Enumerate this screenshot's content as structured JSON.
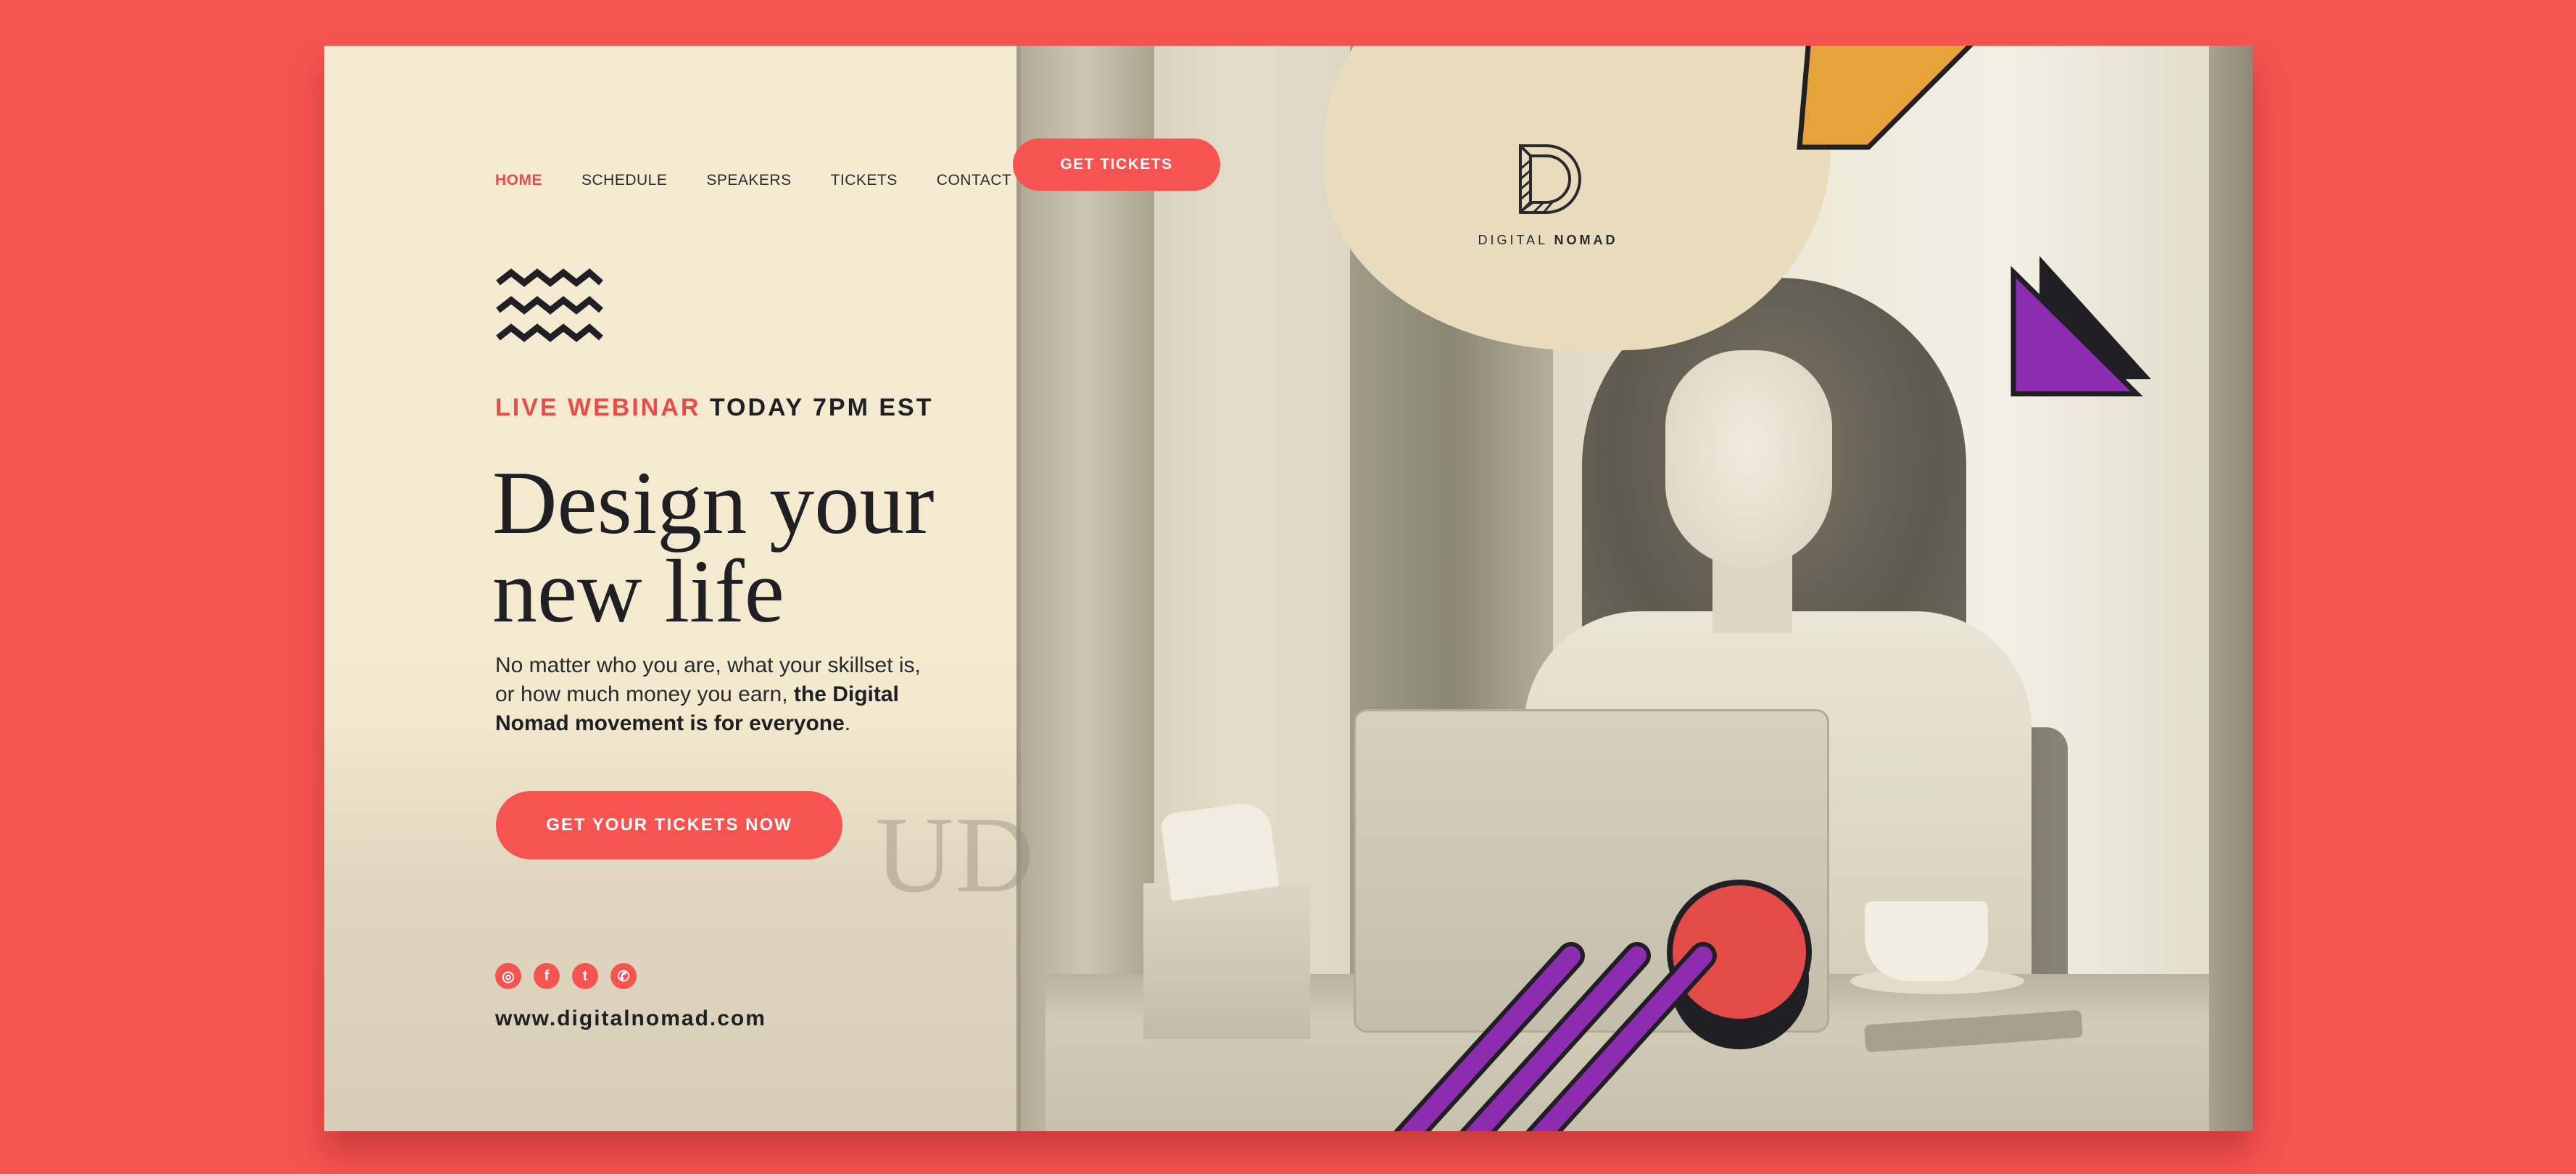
{
  "nav": {
    "items": [
      {
        "label": "HOME",
        "active": true
      },
      {
        "label": "SCHEDULE",
        "active": false
      },
      {
        "label": "SPEAKERS",
        "active": false
      },
      {
        "label": "TICKETS",
        "active": false
      },
      {
        "label": "CONTACT",
        "active": false
      }
    ],
    "cta_label": "GET TICKETS"
  },
  "logo": {
    "name_light": "DIGITAL",
    "name_bold": "NOMAD",
    "icon": "letter-d-icon"
  },
  "hero": {
    "eyebrow_accent": "LIVE WEBINAR",
    "eyebrow_rest": "TODAY 7PM EST",
    "headline_line1": "Design your",
    "headline_line2": "new life",
    "body_plain": "No matter who you are, what your skillset is, or how much money you earn,",
    "body_bold": "the Digital Nomad movement is for everyone",
    "body_end": ".",
    "cta_label": "GET YOUR TICKETS NOW"
  },
  "footer": {
    "socials": [
      {
        "icon": "instagram-icon",
        "glyph": "◎"
      },
      {
        "icon": "facebook-icon",
        "glyph": "f"
      },
      {
        "icon": "twitter-icon",
        "glyph": "t"
      },
      {
        "icon": "whatsapp-icon",
        "glyph": "✆"
      }
    ],
    "url": "www.digitalnomad.com"
  },
  "colors": {
    "accent": "#f75351",
    "background": "#f75351",
    "cream": "#f3ead3",
    "purple": "#8e2cb1",
    "orange": "#e8a23a",
    "dark": "#1f1f24"
  }
}
